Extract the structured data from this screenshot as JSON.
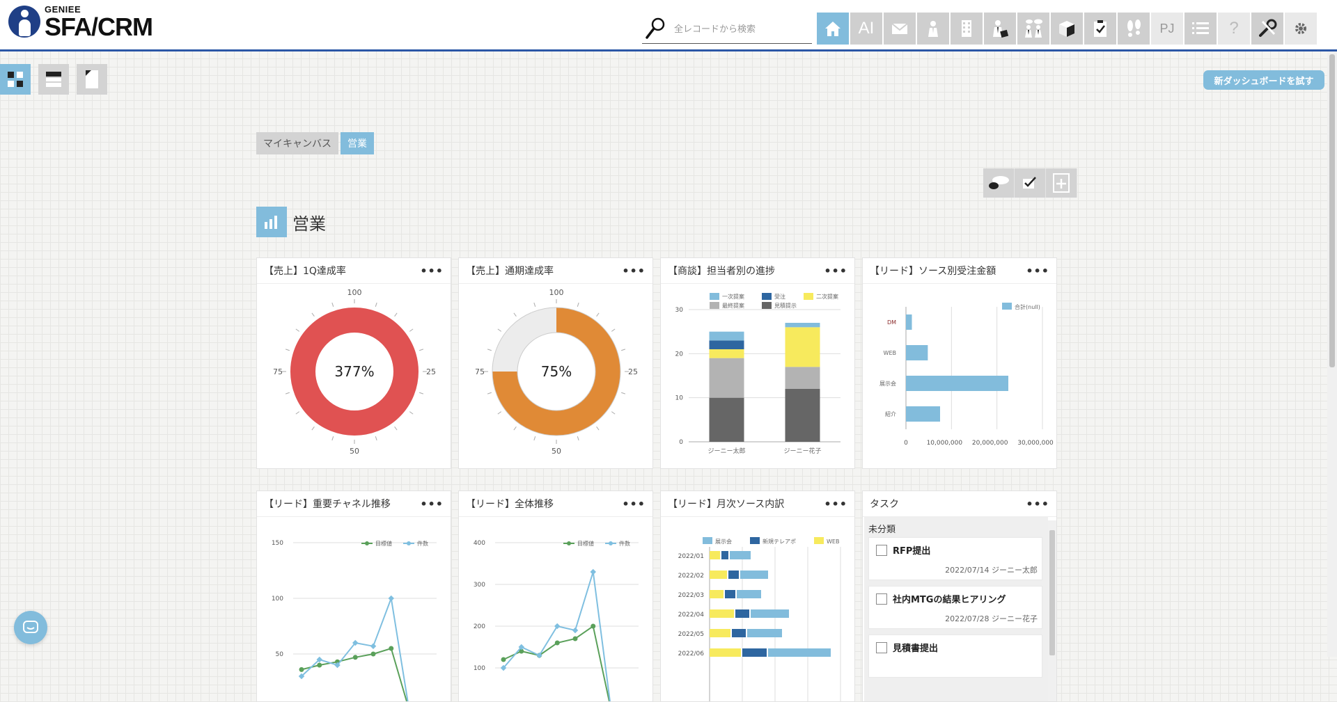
{
  "header": {
    "logo_small": "GENIEE",
    "logo_big": "SFA/CRM",
    "search_placeholder": "全レコードから検索",
    "nav_items": [
      {
        "name": "home-icon",
        "label": "",
        "active": true
      },
      {
        "name": "ai-button",
        "label": "AI"
      },
      {
        "name": "mail-icon",
        "label": ""
      },
      {
        "name": "contact-person-icon",
        "label": ""
      },
      {
        "name": "company-building-icon",
        "label": ""
      },
      {
        "name": "deal-person-icon",
        "label": ""
      },
      {
        "name": "meeting-people-icon",
        "label": ""
      },
      {
        "name": "product-box-icon",
        "label": ""
      },
      {
        "name": "task-clipboard-icon",
        "label": ""
      },
      {
        "name": "activity-footprints-icon",
        "label": ""
      },
      {
        "name": "project-button",
        "label": "PJ"
      },
      {
        "name": "list-icon",
        "label": ""
      },
      {
        "name": "help-icon",
        "label": "?"
      },
      {
        "name": "tools-wrench-icon",
        "label": ""
      },
      {
        "name": "settings-gear-icon",
        "label": ""
      }
    ]
  },
  "toolbar": {
    "try_new_dashboard": "新ダッシュボードを試す"
  },
  "tabs": [
    {
      "label": "マイキャンバス",
      "active": false
    },
    {
      "label": "営業",
      "active": true
    }
  ],
  "page_title": "営業",
  "widgets": {
    "w1": {
      "title": "【売上】1Q達成率",
      "menu": "•••"
    },
    "w2": {
      "title": "【売上】通期達成率",
      "menu": "•••"
    },
    "w3": {
      "title": "【商談】担当者別の進捗",
      "menu": "•••"
    },
    "w4": {
      "title": "【リード】ソース別受注金額",
      "menu": "•••"
    },
    "w5": {
      "title": "【リード】重要チャネル推移",
      "menu": "•••"
    },
    "w6": {
      "title": "【リード】全体推移",
      "menu": "•••"
    },
    "w7": {
      "title": "【リード】月次ソース内訳",
      "menu": "•••"
    },
    "w8": {
      "title": "タスク",
      "menu": "•••"
    }
  },
  "tasks": {
    "category": "未分類",
    "items": [
      {
        "title": "RFP提出",
        "date": "2022/07/14",
        "owner": "ジーニー太郎"
      },
      {
        "title": "社内MTGの結果ヒアリング",
        "date": "2022/07/28",
        "owner": "ジーニー花子"
      },
      {
        "title": "見積書提出",
        "date": "",
        "owner": ""
      }
    ]
  },
  "chart_data": [
    {
      "type": "gauge",
      "name": "【売上】1Q達成率",
      "center_label": "377%",
      "value_percent": 377,
      "ticks": [
        "100",
        "25",
        "50",
        "75"
      ],
      "color": "#e05252"
    },
    {
      "type": "gauge",
      "name": "【売上】通期達成率",
      "center_label": "75%",
      "value_percent": 75,
      "ticks": [
        "100",
        "25",
        "50",
        "75"
      ],
      "color": "#e08a36"
    },
    {
      "type": "bar",
      "stacked": true,
      "categories": [
        "ジーニー太郎",
        "ジーニー花子"
      ],
      "ylim": [
        0,
        30
      ],
      "yticks": [
        0,
        10,
        20,
        30
      ],
      "series": [
        {
          "name": "見積提示",
          "color": "#666666",
          "values": [
            10,
            12
          ]
        },
        {
          "name": "最終提案",
          "color": "#b3b3b3",
          "values": [
            9,
            5
          ]
        },
        {
          "name": "二次提案",
          "color": "#f7ea5d",
          "values": [
            2,
            9
          ]
        },
        {
          "name": "受注",
          "color": "#2e66a0",
          "values": [
            2,
            0
          ]
        },
        {
          "name": "一次提案",
          "color": "#82bcdc",
          "values": [
            2,
            1
          ]
        }
      ]
    },
    {
      "type": "bar",
      "orientation": "horizontal",
      "categories": [
        "DM",
        "WEB",
        "展示会",
        "紹介"
      ],
      "xlim": [
        0,
        30000000
      ],
      "xticks": [
        "0",
        "10,000,000",
        "20,000,000",
        "30,000,000"
      ],
      "series": [
        {
          "name": "合計(null)",
          "color": "#82bcdc",
          "values": [
            1300000,
            4800000,
            22500000,
            7500000
          ]
        }
      ]
    },
    {
      "type": "line",
      "x": [
        "1",
        "2",
        "3",
        "4",
        "5",
        "6",
        "7",
        "8",
        "9"
      ],
      "ylim": [
        0,
        150
      ],
      "yticks": [
        50,
        100,
        150
      ],
      "series": [
        {
          "name": "目標値",
          "color": "#5aa05a",
          "values": [
            36,
            40,
            43,
            47,
            50,
            55,
            0
          ]
        },
        {
          "name": "件数",
          "color": "#7fbfe0",
          "values": [
            30,
            45,
            40,
            60,
            57,
            100,
            0
          ]
        }
      ]
    },
    {
      "type": "line",
      "x": [
        "1",
        "2",
        "3",
        "4",
        "5",
        "6",
        "7",
        "8",
        "9"
      ],
      "ylim": [
        0,
        400
      ],
      "yticks": [
        100,
        200,
        300,
        400
      ],
      "series": [
        {
          "name": "目標値",
          "color": "#5aa05a",
          "values": [
            120,
            140,
            130,
            160,
            170,
            200,
            0
          ]
        },
        {
          "name": "件数",
          "color": "#7fbfe0",
          "values": [
            100,
            150,
            130,
            200,
            190,
            330,
            0
          ]
        }
      ]
    },
    {
      "type": "bar",
      "orientation": "horizontal",
      "stacked": true,
      "categories": [
        "2022/01",
        "2022/02",
        "2022/03",
        "2022/04",
        "2022/05",
        "2022/06"
      ],
      "series": [
        {
          "name": "WEB",
          "color": "#f7ea5d",
          "values": [
            3,
            5,
            4,
            7,
            6,
            9
          ]
        },
        {
          "name": "新規テレアポ",
          "color": "#2e66a0",
          "values": [
            2,
            3,
            3,
            4,
            4,
            7
          ]
        },
        {
          "name": "展示会",
          "color": "#82bcdc",
          "values": [
            6,
            8,
            7,
            11,
            10,
            18
          ]
        }
      ]
    }
  ]
}
